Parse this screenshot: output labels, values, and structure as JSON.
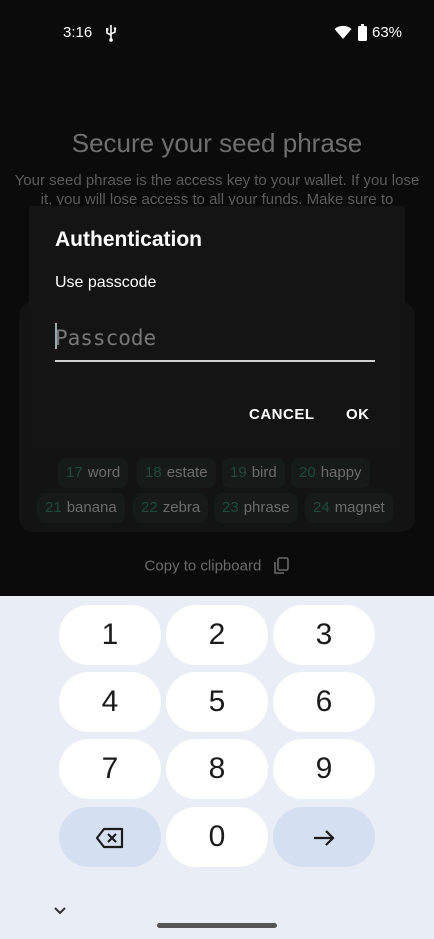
{
  "status_bar": {
    "time": "3:16",
    "battery": "63%"
  },
  "background_screen": {
    "title": "Secure your seed phrase",
    "description": "Your seed phrase is the access key to your wallet. If you lose it, you will lose access to all your funds. Make sure to",
    "words": [
      {
        "num": "17",
        "word": "word"
      },
      {
        "num": "18",
        "word": "estate"
      },
      {
        "num": "19",
        "word": "bird"
      },
      {
        "num": "20",
        "word": "happy"
      },
      {
        "num": "21",
        "word": "banana"
      },
      {
        "num": "22",
        "word": "zebra"
      },
      {
        "num": "23",
        "word": "phrase"
      },
      {
        "num": "24",
        "word": "magnet"
      }
    ],
    "copy_label": "Copy to clipboard"
  },
  "dialog": {
    "title": "Authentication",
    "subtitle": "Use passcode",
    "placeholder": "Passcode",
    "value": "",
    "cancel_label": "CANCEL",
    "ok_label": "OK"
  },
  "keyboard": {
    "keys": [
      "1",
      "2",
      "3",
      "4",
      "5",
      "6",
      "7",
      "8",
      "9",
      "0"
    ],
    "backspace_icon": "backspace-icon",
    "enter_icon": "arrow-right-icon"
  }
}
